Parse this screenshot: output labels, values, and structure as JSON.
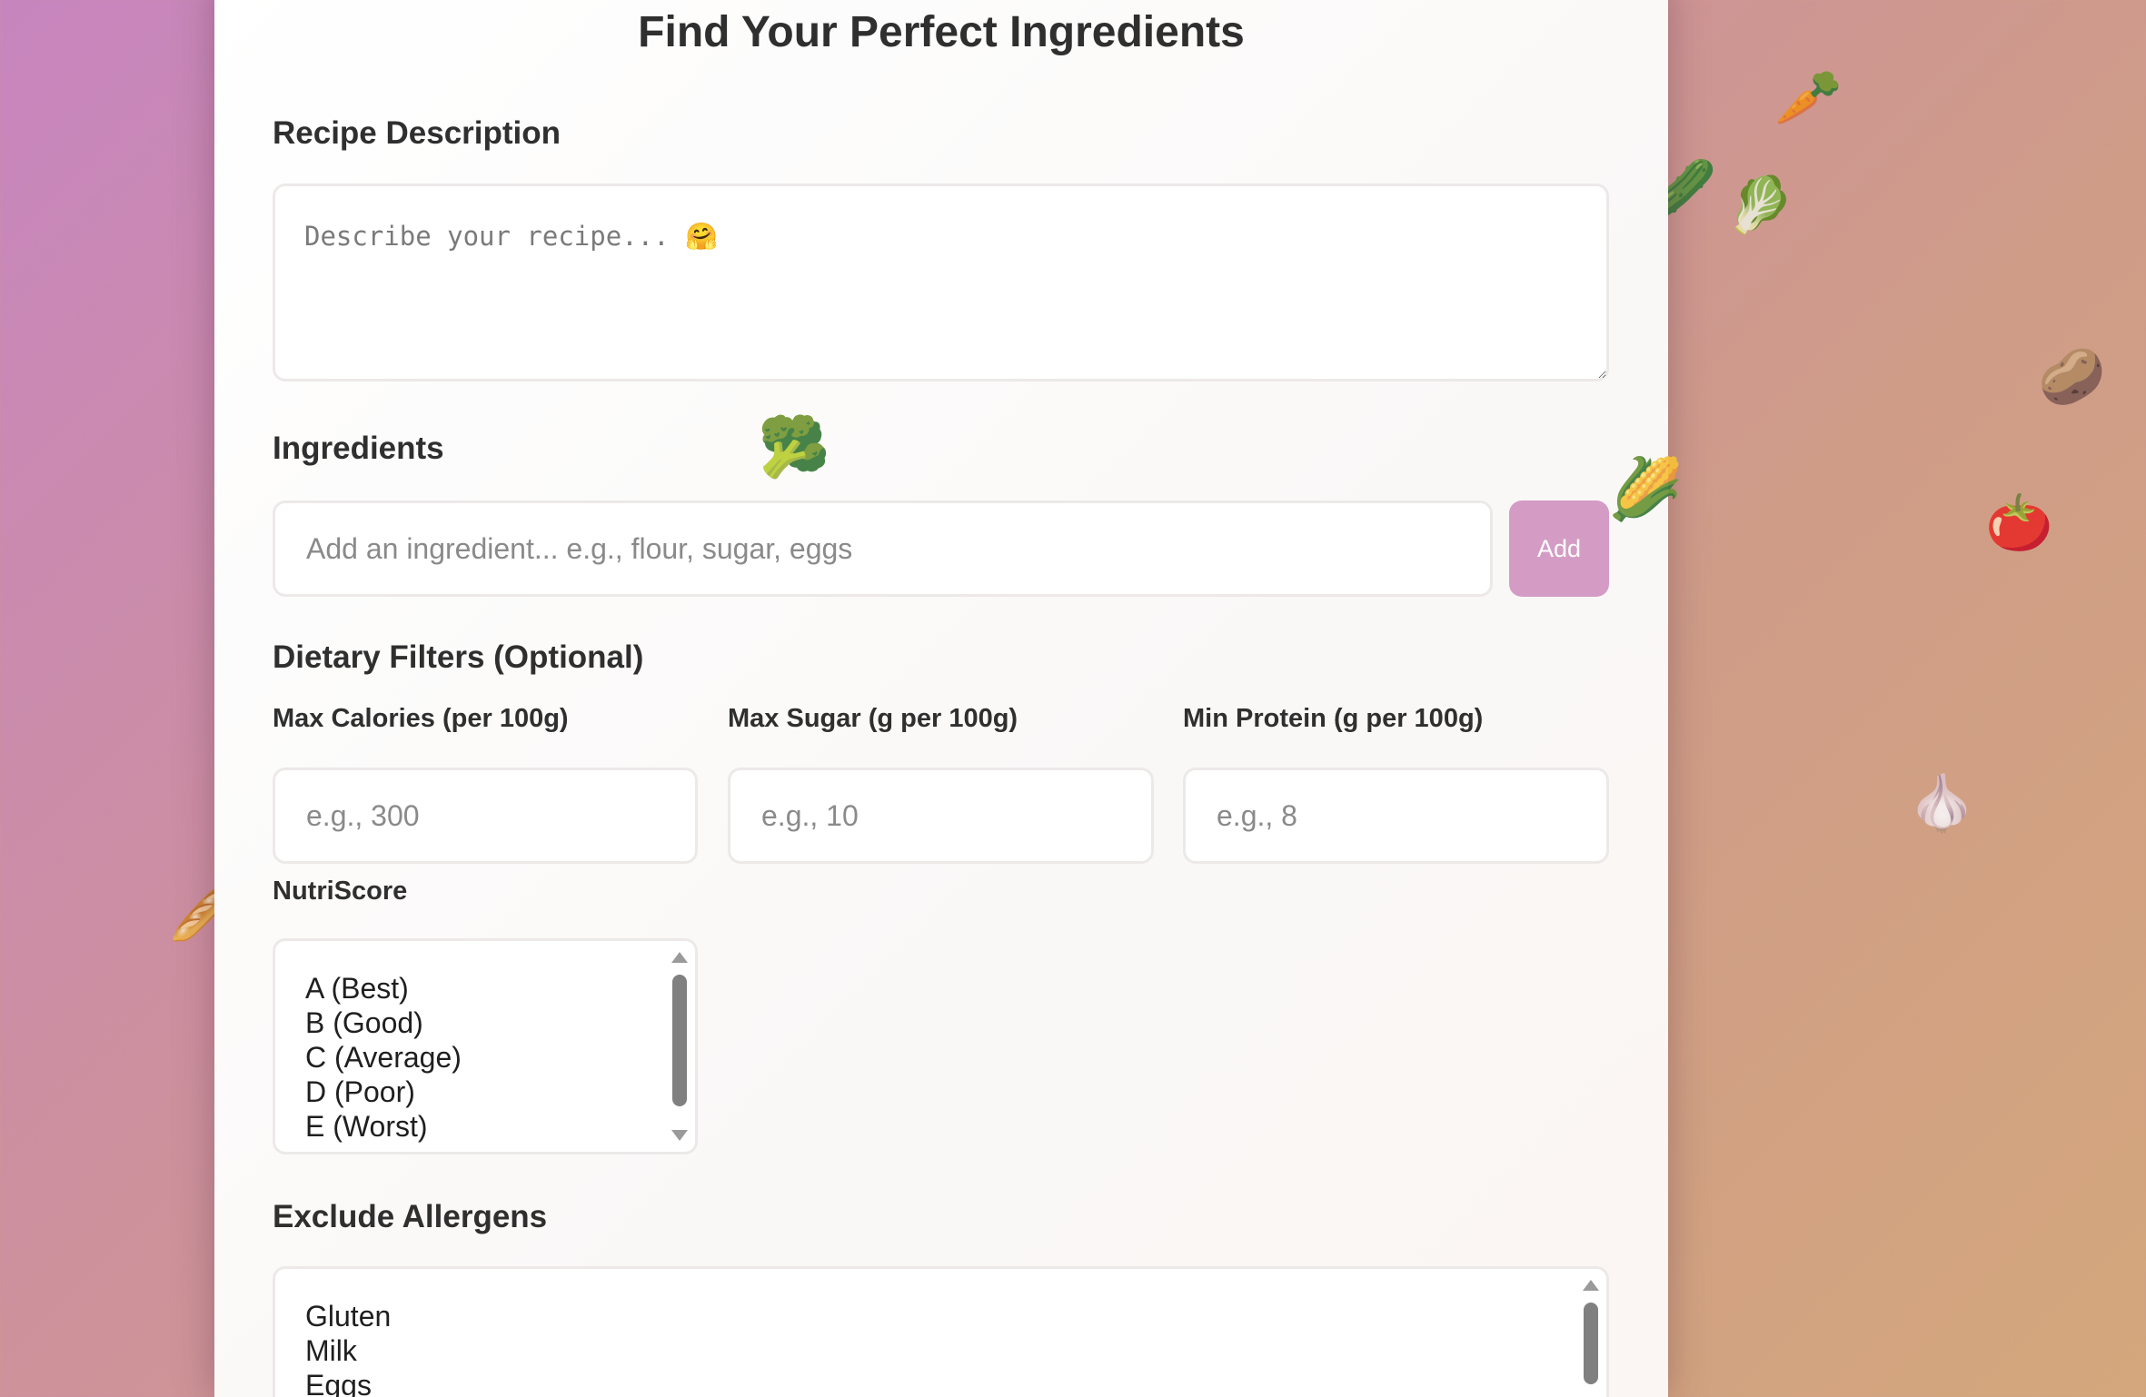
{
  "page": {
    "title": "Find Your Perfect Ingredients"
  },
  "recipe": {
    "label": "Recipe Description",
    "placeholder": "Describe your recipe... 🤗"
  },
  "ingredients": {
    "label": "Ingredients",
    "placeholder": "Add an ingredient... e.g., flour, sugar, eggs",
    "add_label": "Add"
  },
  "dietary": {
    "heading": "Dietary Filters (Optional)",
    "max_calories": {
      "label": "Max Calories (per 100g)",
      "placeholder": "e.g., 300"
    },
    "max_sugar": {
      "label": "Max Sugar (g per 100g)",
      "placeholder": "e.g., 10"
    },
    "min_protein": {
      "label": "Min Protein (g per 100g)",
      "placeholder": "e.g., 8"
    },
    "nutriscore": {
      "label": "NutriScore",
      "options": [
        "A (Best)",
        "B (Good)",
        "C (Average)",
        "D (Poor)",
        "E (Worst)"
      ]
    }
  },
  "allergens": {
    "label": "Exclude Allergens",
    "options": [
      "Gluten",
      "Milk",
      "Eggs"
    ]
  },
  "decorations": {
    "carrot": "🥕",
    "cucumber": "🥒",
    "leafy_green": "🥬",
    "potato": "🥔",
    "broccoli": "🥦",
    "corn": "🌽",
    "tomato": "🍅",
    "garlic": "🧄",
    "bread": "🥖"
  },
  "colors": {
    "accent_button": "#d49cc5",
    "background_start": "#c785bf",
    "background_end": "#d4a77c"
  }
}
